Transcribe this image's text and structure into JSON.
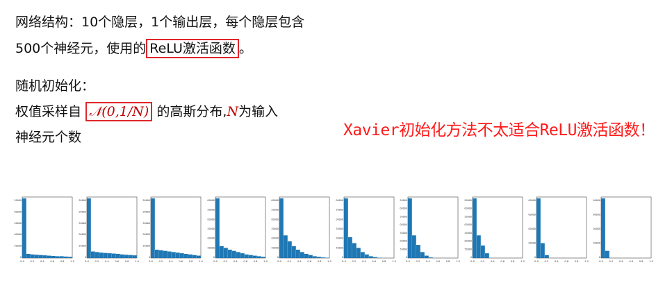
{
  "text": {
    "line1": "网络结构：10个隐层，1个输出层，每个隐层包含",
    "line2_prefix": "500个神经元，使用的",
    "line2_boxed": "ReLU激活函数",
    "line2_suffix": "。",
    "line3": "随机初始化：",
    "line4_prefix": "权值采样自",
    "formula": "𝒩(0,1/𝑁)",
    "line4_suffix_a": "的高斯分布,",
    "line4_var": "𝑁",
    "line4_suffix_b": "为输入",
    "line5": "神经元个数",
    "callout": "Xavier初始化方法不太适合ReLU激活函数！"
  },
  "colors": {
    "box": "#e0262a",
    "callout": "#ff1a1a",
    "bar": "#1f77b4"
  },
  "chart_data": [
    {
      "type": "bar",
      "xlim": [
        0,
        1
      ],
      "xticks": [
        "0.0",
        "0.2",
        "0.4",
        "0.6",
        "0.8",
        "1.0"
      ],
      "yticks": [
        "250000",
        "200000",
        "150000",
        "100000",
        "50000",
        "0"
      ],
      "values": [
        1.0,
        0.07,
        0.06,
        0.055,
        0.05,
        0.045,
        0.04,
        0.035,
        0.03,
        0.03,
        0.025,
        0.02
      ]
    },
    {
      "type": "bar",
      "xlim": [
        0,
        1
      ],
      "xticks": [
        "0.0",
        "0.2",
        "0.4",
        "0.6",
        "0.8",
        "1.0"
      ],
      "yticks": [
        "250000",
        "200000",
        "150000",
        "100000",
        "50000",
        "0"
      ],
      "values": [
        1.0,
        0.11,
        0.1,
        0.09,
        0.085,
        0.08,
        0.075,
        0.07,
        0.06,
        0.055,
        0.05,
        0.045
      ]
    },
    {
      "type": "bar",
      "xlim": [
        0,
        1
      ],
      "xticks": [
        "0.0",
        "0.2",
        "0.4",
        "0.6",
        "0.8",
        "1.0"
      ],
      "yticks": [
        "250000",
        "200000",
        "150000",
        "100000",
        "50000",
        "0"
      ],
      "values": [
        1.0,
        0.14,
        0.13,
        0.12,
        0.11,
        0.1,
        0.09,
        0.08,
        0.07,
        0.06,
        0.05,
        0.04
      ]
    },
    {
      "type": "bar",
      "xlim": [
        0,
        1
      ],
      "xticks": [
        "0.0",
        "0.2",
        "0.4",
        "0.6",
        "0.8",
        "1.0"
      ],
      "yticks": [
        "300000",
        "250000",
        "200000",
        "150000",
        "100000",
        "50000",
        "0"
      ],
      "values": [
        1.0,
        0.2,
        0.17,
        0.14,
        0.12,
        0.1,
        0.08,
        0.06,
        0.05,
        0.04,
        0.03,
        0.02
      ]
    },
    {
      "type": "bar",
      "xlim": [
        0,
        1
      ],
      "xticks": [
        "0.0",
        "0.2",
        "0.4",
        "0.6",
        "0.8",
        "1.0"
      ],
      "yticks": [
        "300000",
        "250000",
        "200000",
        "150000",
        "100000",
        "50000",
        "0"
      ],
      "values": [
        1.0,
        0.38,
        0.28,
        0.2,
        0.14,
        0.1,
        0.07,
        0.05,
        0.03,
        0.02,
        0.01,
        0.005
      ]
    },
    {
      "type": "bar",
      "xlim": [
        0,
        1
      ],
      "xticks": [
        "0.0",
        "0.2",
        "0.4",
        "0.6",
        "0.8",
        "1.0"
      ],
      "yticks": [
        "300000",
        "250000",
        "200000",
        "150000",
        "100000",
        "50000",
        "0"
      ],
      "values": [
        1.0,
        0.35,
        0.25,
        0.17,
        0.1,
        0.06,
        0.03,
        0.015,
        0.005
      ]
    },
    {
      "type": "bar",
      "xlim": [
        0,
        1
      ],
      "xticks": [
        "0.0",
        "0.2",
        "0.4",
        "0.6",
        "0.8",
        "1.0"
      ],
      "yticks": [
        "350000",
        "300000",
        "250000",
        "200000",
        "150000",
        "100000",
        "50000",
        "0"
      ],
      "values": [
        1.0,
        0.38,
        0.22,
        0.1,
        0.04,
        0.01
      ]
    },
    {
      "type": "bar",
      "xlim": [
        0,
        1
      ],
      "xticks": [
        "0.0",
        "0.2",
        "0.4",
        "0.6",
        "0.8",
        "1.0"
      ],
      "yticks": [
        "350000",
        "300000",
        "250000",
        "200000",
        "150000",
        "100000",
        "50000",
        "0"
      ],
      "values": [
        1.0,
        0.38,
        0.21,
        0.08
      ]
    },
    {
      "type": "bar",
      "xlim": [
        0,
        1
      ],
      "xticks": [
        "0.0",
        "0.2",
        "0.4",
        "0.6",
        "0.8",
        "1.0"
      ],
      "yticks": [
        "400000",
        "300000",
        "200000",
        "100000",
        "0"
      ],
      "values": [
        1.0,
        0.25,
        0.05
      ]
    },
    {
      "type": "bar",
      "xlim": [
        0,
        1
      ],
      "xticks": [
        "0.0",
        "0.2",
        "0.4",
        "0.6",
        "0.8",
        "1.0"
      ],
      "yticks": [
        "400000",
        "300000",
        "200000",
        "100000",
        "0"
      ],
      "values": [
        1.0,
        0.12
      ]
    }
  ]
}
